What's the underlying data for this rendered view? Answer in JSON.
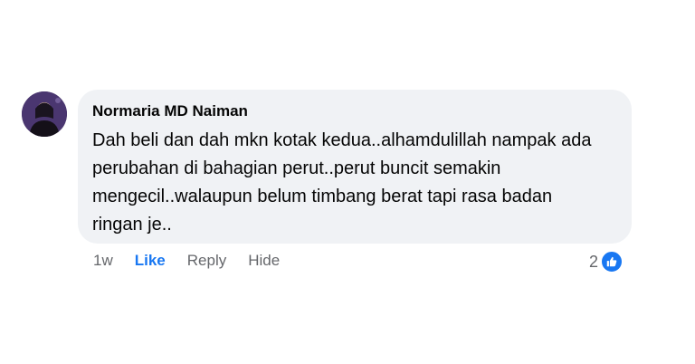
{
  "comment": {
    "author": "Normaria MD Naiman",
    "text": "Dah beli dan dah mkn kotak kedua..alhamdulillah nampak ada perubahan di bahagian perut..perut buncit semakin mengecil..walaupun belum timbang berat tapi rasa badan ringan je..",
    "timestamp": "1w",
    "reaction_count": "2"
  },
  "actions": {
    "like_label": "Like",
    "reply_label": "Reply",
    "hide_label": "Hide"
  },
  "icons": {
    "avatar": "profile-photo",
    "reaction": "thumbs-up-icon"
  },
  "colors": {
    "bubble_bg": "#f0f2f5",
    "like_blue": "#1877f2",
    "secondary_text": "#65676b"
  }
}
